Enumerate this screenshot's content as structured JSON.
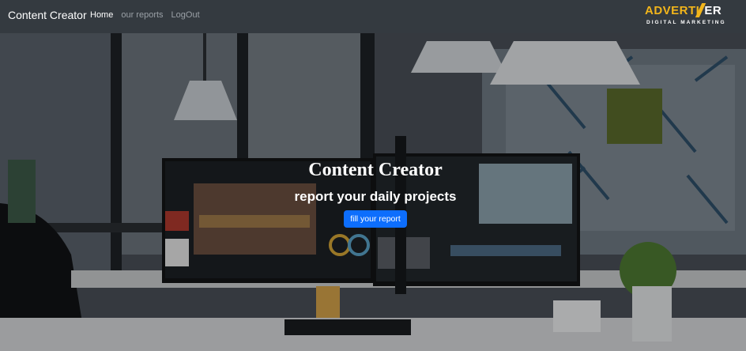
{
  "navbar": {
    "brand": "Content Creator",
    "links": [
      {
        "label": "Home",
        "active": true
      },
      {
        "label": "our reports",
        "active": false
      },
      {
        "label": "LogOut",
        "active": false
      }
    ],
    "logo": {
      "main_part1": "ADVERTI",
      "main_part2": "ER",
      "tagline": "DIGITAL MARKETING"
    }
  },
  "hero": {
    "title": "Content Creator",
    "subtitle": "report your daily projects",
    "button_label": "fill your report"
  },
  "colors": {
    "navbar_bg": "#343a40",
    "button_bg": "#0d6efd",
    "logo_accent": "#f2b51b"
  }
}
